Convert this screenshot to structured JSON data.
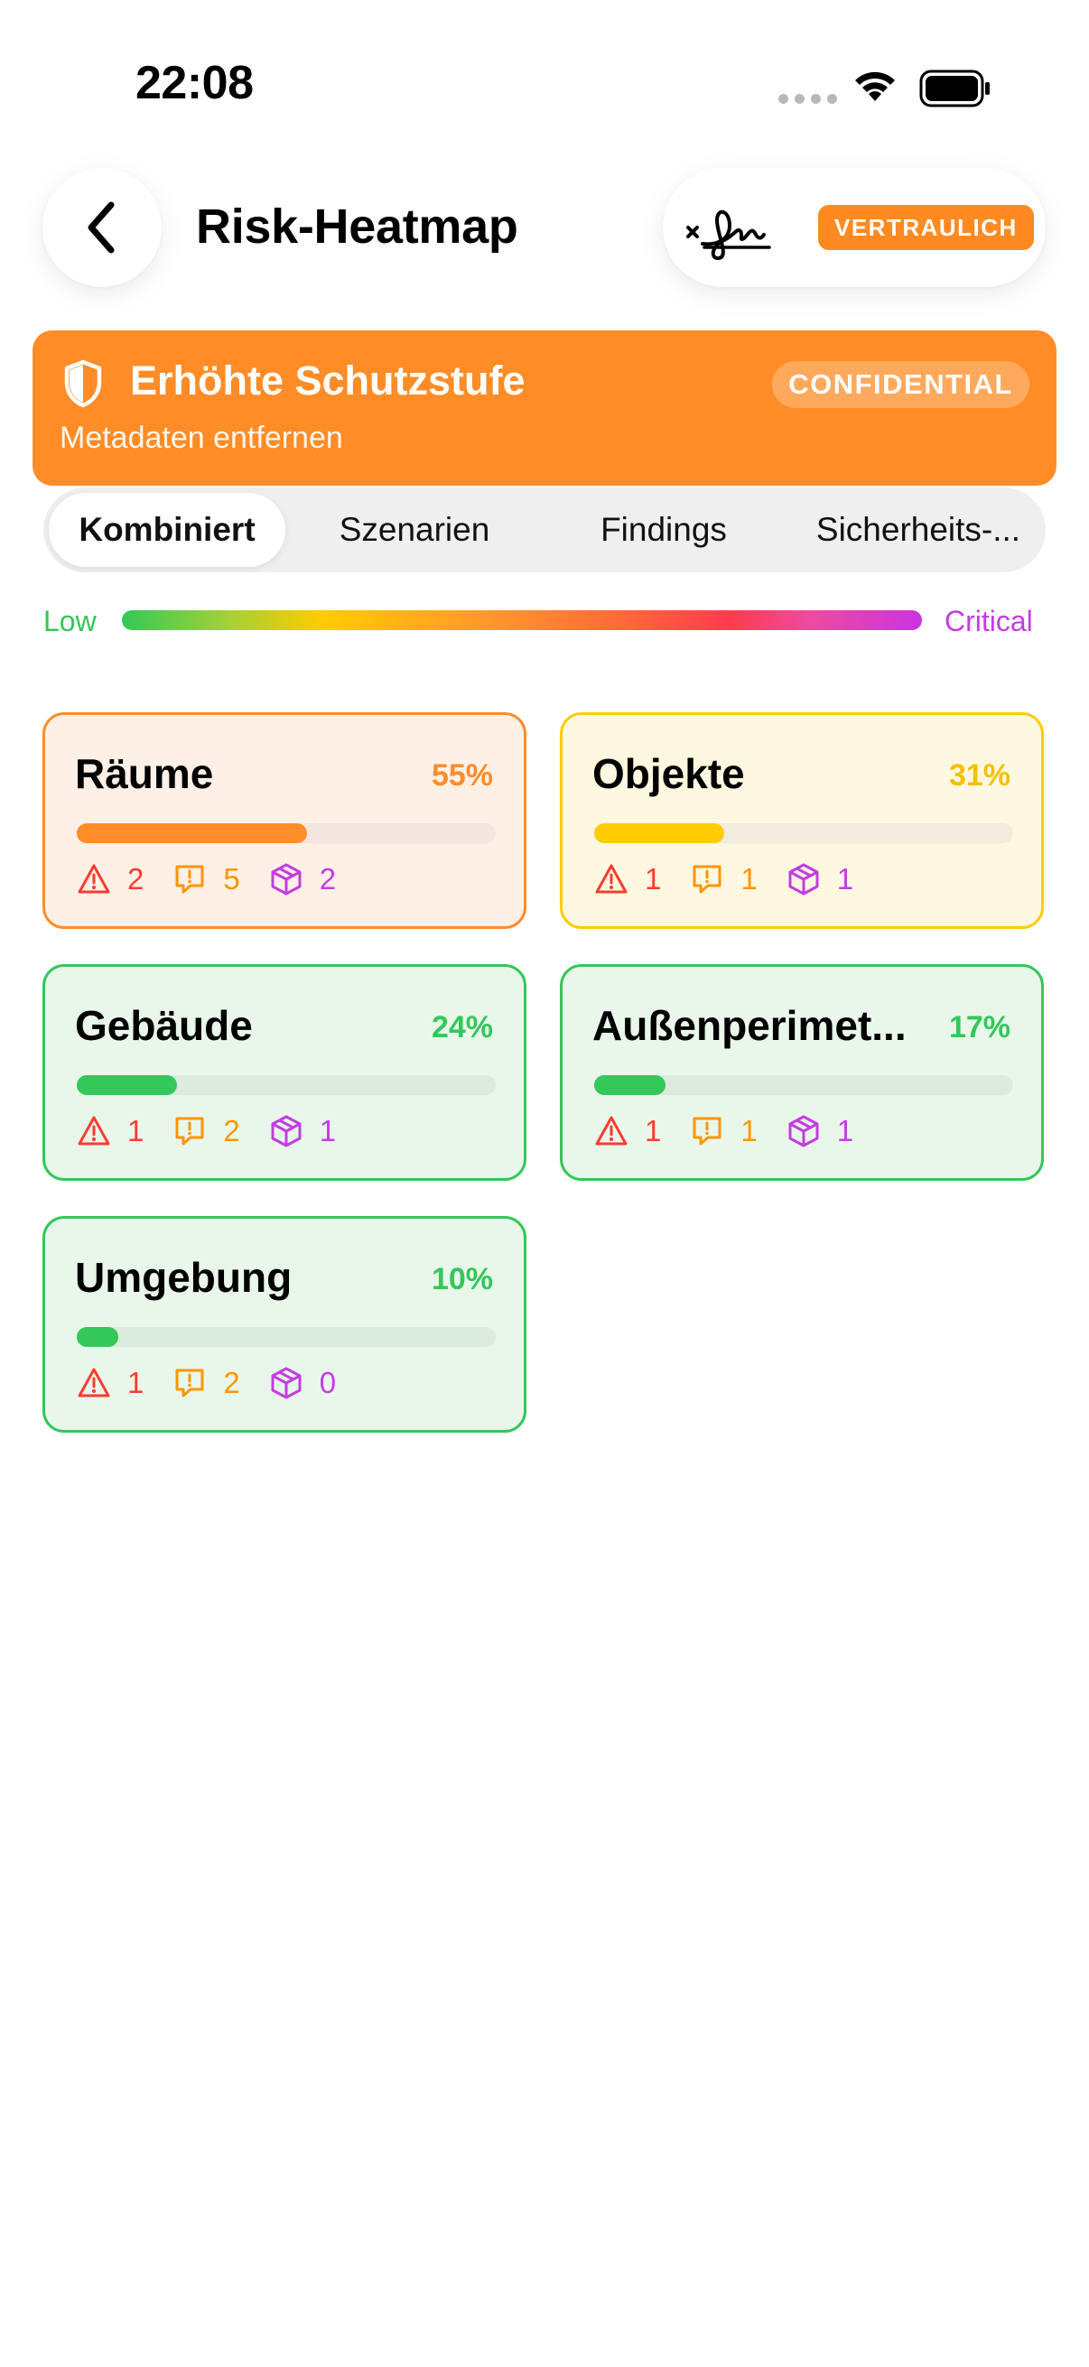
{
  "status_bar": {
    "time": "22:08"
  },
  "header": {
    "title": "Risk-Heatmap",
    "badge": "VERTRAULICH"
  },
  "banner": {
    "title": "Erhöhte Schutzstufe",
    "subtitle": "Metadaten entfernen",
    "badge": "CONFIDENTIAL"
  },
  "tabs": [
    {
      "label": "Kombiniert",
      "active": true
    },
    {
      "label": "Szenarien",
      "active": false
    },
    {
      "label": "Findings",
      "active": false
    },
    {
      "label": "Sicherheits-...",
      "active": false
    }
  ],
  "legend": {
    "low": "Low",
    "critical": "Critical"
  },
  "cards": [
    {
      "title": "Räume",
      "percent_label": "55%",
      "progress": 0.55,
      "warnings": "2",
      "findings": "5",
      "objects": "2",
      "level": "orange"
    },
    {
      "title": "Objekte",
      "percent_label": "31%",
      "progress": 0.31,
      "warnings": "1",
      "findings": "1",
      "objects": "1",
      "level": "yellow"
    },
    {
      "title": "Gebäude",
      "percent_label": "24%",
      "progress": 0.24,
      "warnings": "1",
      "findings": "2",
      "objects": "1",
      "level": "green"
    },
    {
      "title": "Außenperimet...",
      "percent_label": "17%",
      "progress": 0.17,
      "warnings": "1",
      "findings": "1",
      "objects": "1",
      "level": "green"
    },
    {
      "title": "Umgebung",
      "percent_label": "10%",
      "progress": 0.1,
      "warnings": "1",
      "findings": "2",
      "objects": "0",
      "level": "green"
    }
  ],
  "colors": {
    "orange": "#ff8c2a",
    "yellow": "#ffcc00",
    "green": "#34c759",
    "red": "#ff3b30",
    "purple": "#c43de0"
  },
  "icons": [
    "back-chevron-icon",
    "signature-icon",
    "shield-icon",
    "warning-triangle-icon",
    "exclamation-bubble-icon",
    "cube-icon",
    "wifi-icon",
    "battery-icon",
    "signal-icon"
  ]
}
